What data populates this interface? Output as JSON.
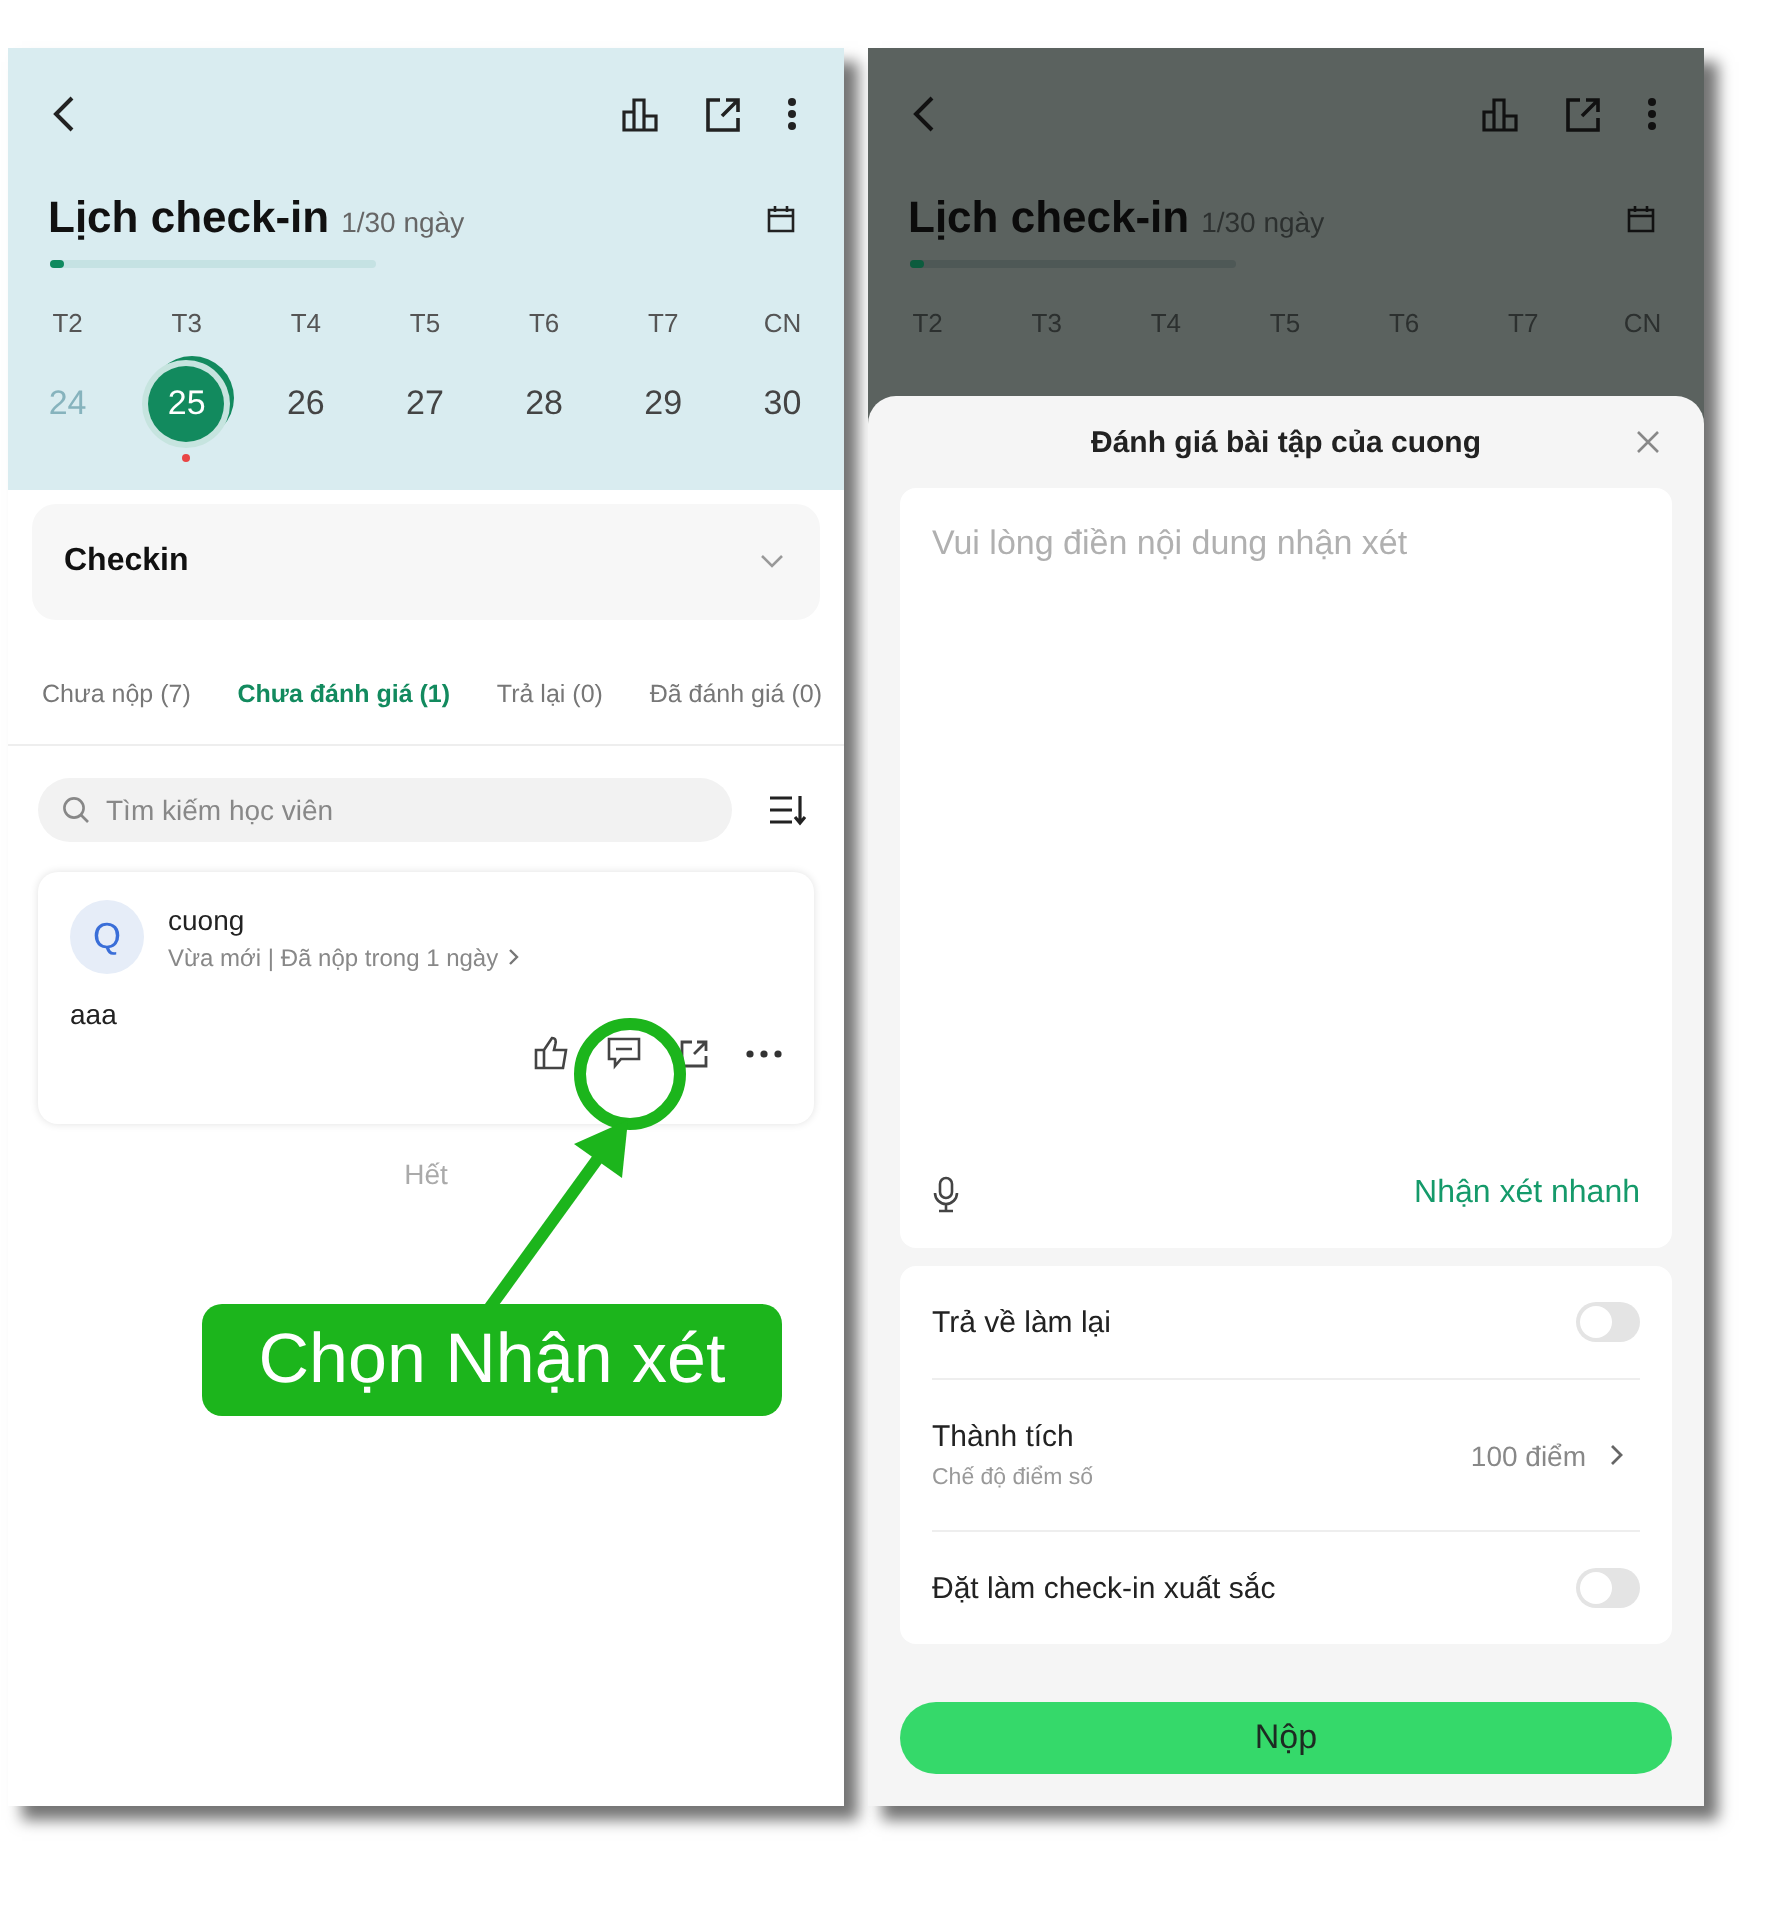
{
  "left_screen": {
    "calendar": {
      "title": "Lịch check-in",
      "progress_text": "1/30 ngày",
      "level": 0.033,
      "days": [
        {
          "weekday": "T2",
          "date": "24",
          "past": true,
          "selected": false,
          "marked": false
        },
        {
          "weekday": "T3",
          "date": "25",
          "past": false,
          "selected": true,
          "marked": true
        },
        {
          "weekday": "T4",
          "date": "26",
          "past": false,
          "selected": false,
          "marked": false
        },
        {
          "weekday": "T5",
          "date": "27",
          "past": false,
          "selected": false,
          "marked": false
        },
        {
          "weekday": "T6",
          "date": "28",
          "past": false,
          "selected": false,
          "marked": false
        },
        {
          "weekday": "T7",
          "date": "29",
          "past": false,
          "selected": false,
          "marked": false
        },
        {
          "weekday": "CN",
          "date": "30",
          "past": false,
          "selected": false,
          "marked": false
        }
      ]
    },
    "section_dropdown": "Checkin",
    "tabs": [
      {
        "label": "Chưa nộp (7)",
        "selected": false
      },
      {
        "label": "Chưa đánh giá (1)",
        "selected": true
      },
      {
        "label": "Trả lại (0)",
        "selected": false
      },
      {
        "label": "Đã đánh giá (0)",
        "selected": false
      }
    ],
    "search": {
      "placeholder": "Tìm kiếm học viên"
    },
    "submission": {
      "avatar": "Q",
      "name": "cuong",
      "meta": "Vừa mới | Đã nộp trong 1 ngày",
      "content": "aaa"
    },
    "end_text": "Hết"
  },
  "annotation": {
    "label": "Chọn Nhận xét"
  },
  "right_screen": {
    "background": {
      "title": "Lịch check-in",
      "progress_text": "1/30 ngày",
      "level": 0.033,
      "weekdays": [
        "T2",
        "T3",
        "T4",
        "T5",
        "T6",
        "T7",
        "CN"
      ]
    },
    "sheet": {
      "title": "Đánh giá bài tập của cuong",
      "comment": {
        "placeholder": "Vui lòng điền nội dung nhận xét"
      },
      "quick_comment": "Nhận xét nhanh",
      "settings": [
        {
          "kind": "toggle",
          "label": "Trả về làm lại",
          "on": false
        },
        {
          "kind": "value",
          "label": "Thành tích",
          "sublabel": "Chế độ điểm số",
          "value": "100 điểm"
        },
        {
          "kind": "toggle",
          "label": "Đặt làm check-in xuất sắc",
          "on": false
        }
      ],
      "submit": "Nộp"
    }
  }
}
